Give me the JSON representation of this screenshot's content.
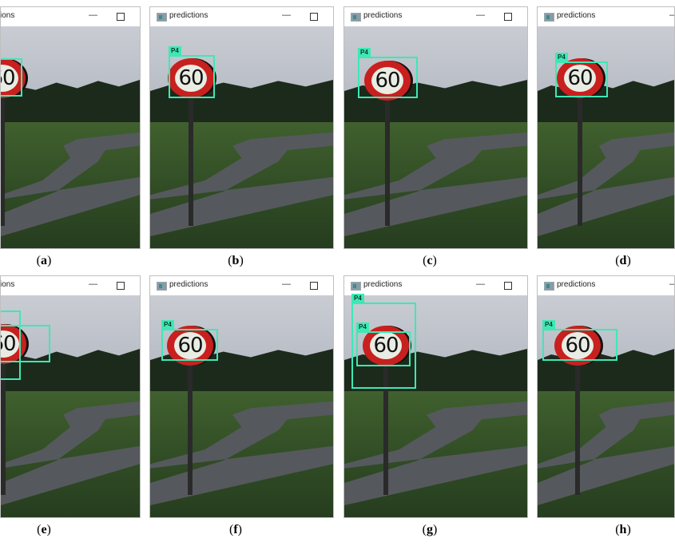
{
  "window_title": "predictions",
  "minimize_glyph": "—",
  "sign_text": "60",
  "box_label": "P4",
  "box_color": "#3ee8b5",
  "panels": [
    {
      "id": "a",
      "caption_open": "(",
      "caption_letter": "a",
      "caption_close": ")",
      "boxes": 1,
      "labels": false
    },
    {
      "id": "b",
      "caption_open": "(",
      "caption_letter": "b",
      "caption_close": ")",
      "boxes": 1,
      "labels": true
    },
    {
      "id": "c",
      "caption_open": "(",
      "caption_letter": "c",
      "caption_close": ")",
      "boxes": 1,
      "labels": true
    },
    {
      "id": "d",
      "caption_open": "(",
      "caption_letter": "d",
      "caption_close": ")",
      "boxes": 1,
      "labels": true
    },
    {
      "id": "e",
      "caption_open": "(",
      "caption_letter": "e",
      "caption_close": ")",
      "boxes": 2,
      "labels": false
    },
    {
      "id": "f",
      "caption_open": "(",
      "caption_letter": "f",
      "caption_close": ")",
      "boxes": 1,
      "labels": true
    },
    {
      "id": "g",
      "caption_open": "(",
      "caption_letter": "g",
      "caption_close": ")",
      "boxes": 2,
      "labels": true
    },
    {
      "id": "h",
      "caption_open": "(",
      "caption_letter": "h",
      "caption_close": ")",
      "boxes": 1,
      "labels": true
    }
  ]
}
